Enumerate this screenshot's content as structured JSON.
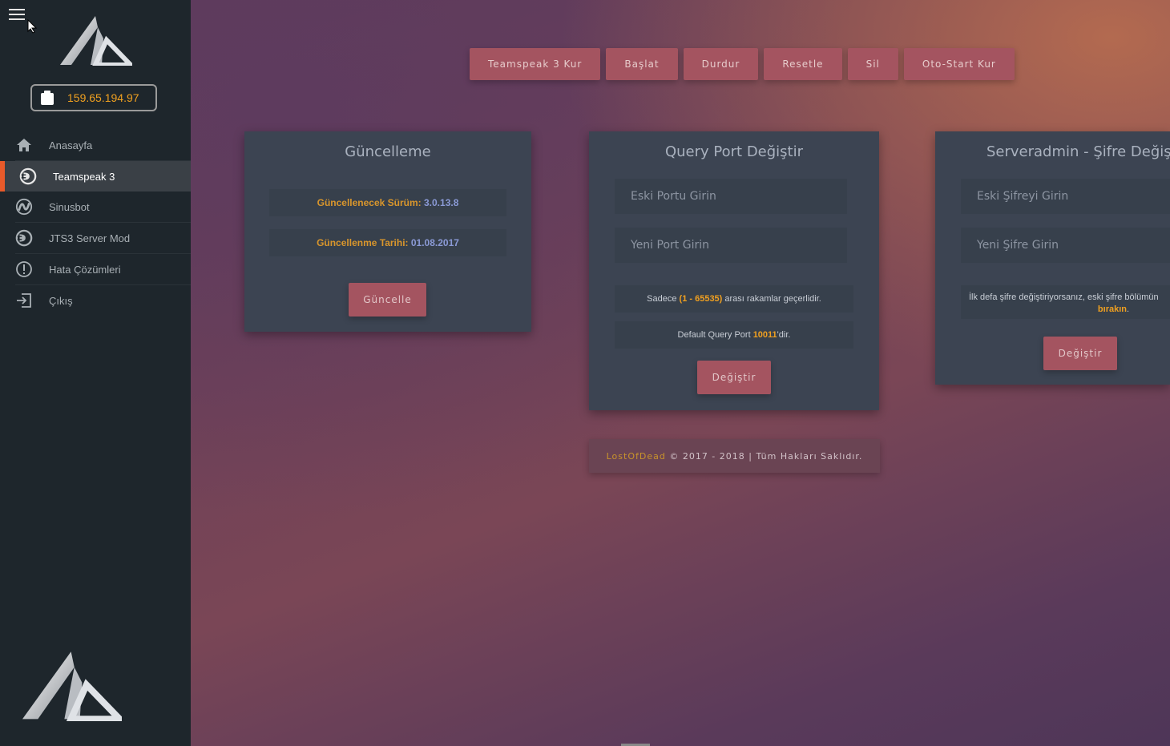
{
  "sidebar": {
    "ip": "159.65.194.97",
    "items": [
      {
        "label": "Anasayfa",
        "icon": "home-icon"
      },
      {
        "label": "Teamspeak 3",
        "icon": "teamspeak-icon"
      },
      {
        "label": "Sinusbot",
        "icon": "sinusbot-icon"
      },
      {
        "label": "JTS3 Server Mod",
        "icon": "teamspeak-icon"
      },
      {
        "label": "Hata Çözümleri",
        "icon": "alert-icon"
      },
      {
        "label": "Çıkış",
        "icon": "logout-icon"
      }
    ],
    "active_index": 1
  },
  "topbar": {
    "buttons": [
      "Teamspeak 3 Kur",
      "Başlat",
      "Durdur",
      "Resetle",
      "Sil",
      "Oto-Start Kur"
    ]
  },
  "update_card": {
    "title": "Güncelleme",
    "version_label": "Güncellenecek Sürüm:",
    "version_value": "3.0.13.8",
    "date_label": "Güncellenme Tarihi:",
    "date_value": "01.08.2017",
    "button": "Güncelle"
  },
  "query_card": {
    "title": "Query Port Değiştir",
    "old_placeholder": "Eski Portu Girin",
    "new_placeholder": "Yeni Port Girin",
    "info_prefix": "Sadece",
    "info_range": "(1 - 65535)",
    "info_suffix": "arası rakamlar geçerlidir.",
    "default_prefix": "Default Query Port",
    "default_port": "10011",
    "default_suffix": "'dir.",
    "button": "Değiştir"
  },
  "password_card": {
    "title": "Serveradmin - Şifre Değişti",
    "old_placeholder": "Eski Şifreyi Girin",
    "new_placeholder": "Yeni Şifre Girin",
    "info_text": "İlk defa şifre değiştiriyorsanız, eski şifre bölümün",
    "info_highlight": "bırakın",
    "info_end": ".",
    "button": "Değiştir"
  },
  "footer": {
    "brand": "LostOfDead",
    "text": " © 2017 - 2018 | Tüm Hakları Saklıdır."
  },
  "colors": {
    "accent_orange": "#e85a2a",
    "button": "#a45460",
    "sidebar": "#1e262c",
    "ip_text": "#f0a020"
  }
}
